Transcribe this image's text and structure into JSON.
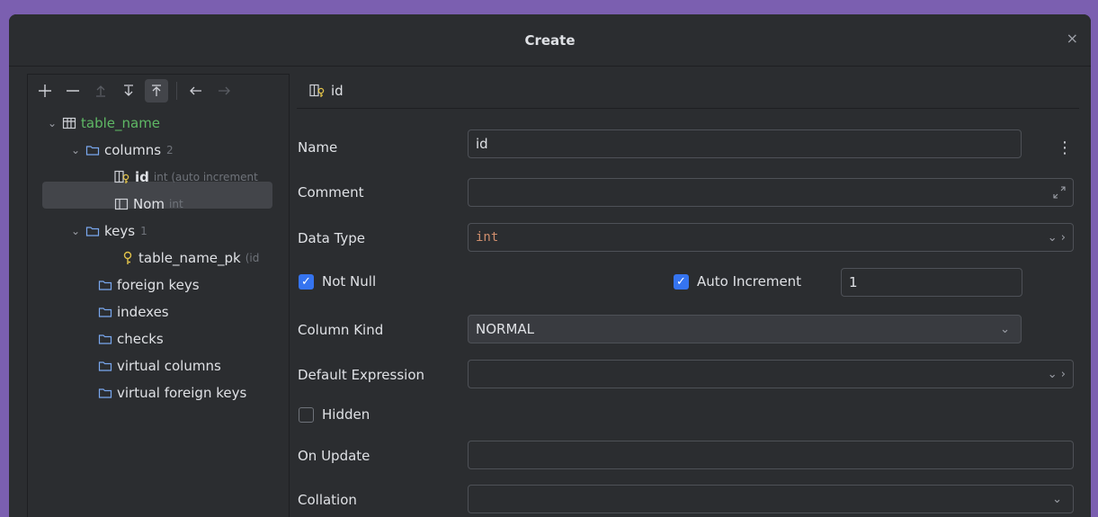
{
  "dialog": {
    "title": "Create",
    "close_glyph": "×"
  },
  "tree": {
    "root": {
      "label": "table_name"
    },
    "columns": {
      "label": "columns",
      "count": "2"
    },
    "col_id": {
      "label": "id",
      "meta": "int (auto increment"
    },
    "col_nom": {
      "label": "Nom",
      "meta": "int"
    },
    "keys": {
      "label": "keys",
      "count": "1"
    },
    "key_pk": {
      "label": "table_name_pk",
      "meta": "(id"
    },
    "foreign_keys": {
      "label": "foreign keys"
    },
    "indexes": {
      "label": "indexes"
    },
    "checks": {
      "label": "checks"
    },
    "virtual_columns": {
      "label": "virtual columns"
    },
    "virtual_foreign_keys": {
      "label": "virtual foreign keys"
    }
  },
  "editor": {
    "header": "id",
    "name": {
      "label": "Name",
      "value": "id"
    },
    "comment": {
      "label": "Comment",
      "value": ""
    },
    "data_type": {
      "label": "Data Type",
      "value": "int"
    },
    "not_null": {
      "label": "Not Null",
      "checked": true
    },
    "auto_increment": {
      "label": "Auto Increment",
      "checked": true,
      "value": "1"
    },
    "column_kind": {
      "label": "Column Kind",
      "value": "NORMAL"
    },
    "default_expression": {
      "label": "Default Expression",
      "value": ""
    },
    "hidden": {
      "label": "Hidden",
      "checked": false
    },
    "on_update": {
      "label": "On Update",
      "value": ""
    },
    "collation": {
      "label": "Collation",
      "value": ""
    }
  },
  "colors": {
    "accent": "#3574f0",
    "table_name": "#5fb865",
    "type_text": "#cf8e6d",
    "key_icon": "#e2c34a"
  }
}
